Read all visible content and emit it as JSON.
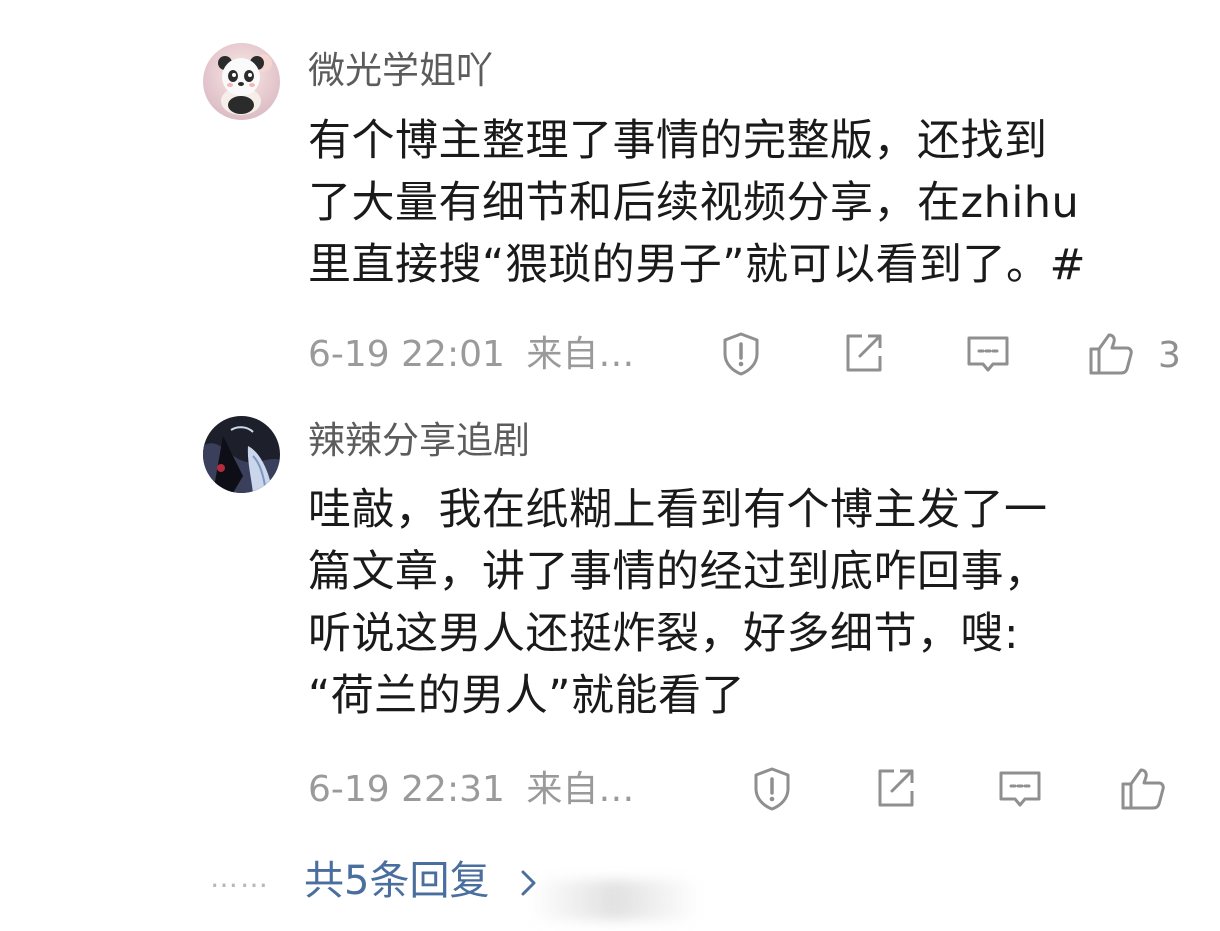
{
  "comments": [
    {
      "username": "微光学姐吖",
      "avatar_icon": "panda-avatar",
      "lines": [
        "有个博主整理了事情的完整版，还找到",
        "了大量有细节和后续视频分享，在zhihu",
        "里直接搜“猥琐的男子”就可以看到了。#"
      ],
      "time": "6-19 22:01",
      "source": "来自…",
      "like_count": "3"
    },
    {
      "username": "辣辣分享追剧",
      "avatar_icon": "anime-avatar",
      "lines": [
        "哇敲，我在纸糊上看到有个博主发了一",
        "篇文章，讲了事情的经过到底咋回事，",
        "听说这男人还挺炸裂，好多细节，嗖:",
        "“荷兰的男人”就能看了"
      ],
      "time": "6-19 22:31",
      "source": "来自…",
      "like_count": ""
    }
  ],
  "footer": {
    "dots": "……",
    "more_replies": "共5条回复"
  },
  "colors": {
    "text": "#1a1a1a",
    "username": "#5c5c5c",
    "meta": "#9a9a9a",
    "link": "#4a6e9e"
  }
}
